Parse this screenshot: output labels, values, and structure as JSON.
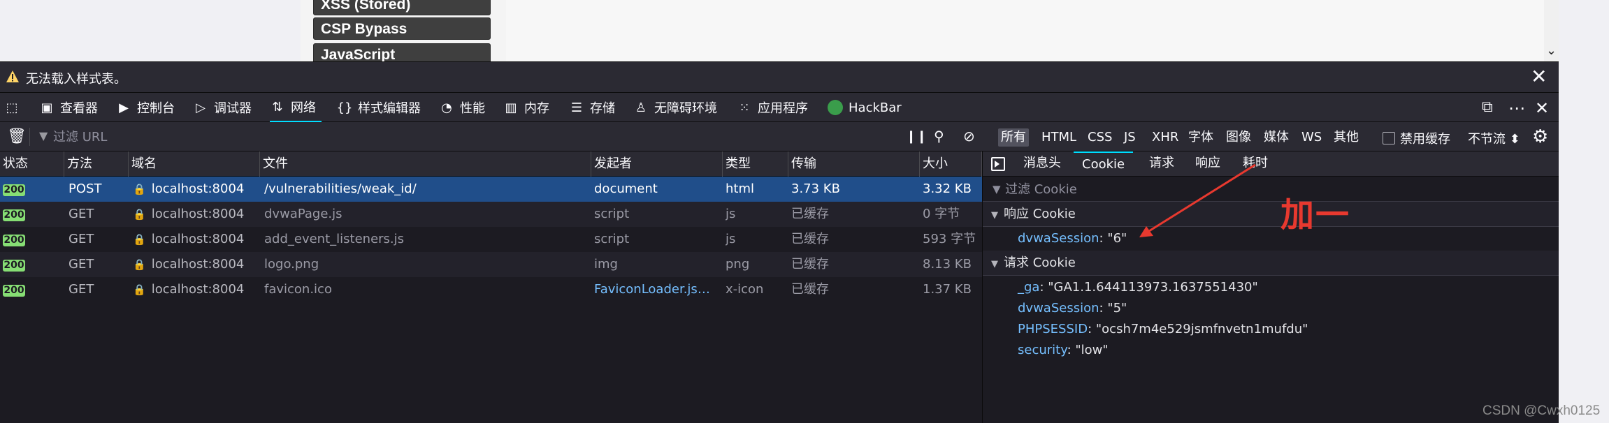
{
  "page": {
    "menu_items": [
      "XSS (Stored)",
      "CSP Bypass",
      "JavaScript"
    ]
  },
  "notice": {
    "text": "无法载入样式表。",
    "close": "✕"
  },
  "toolbar": {
    "tabs": [
      {
        "label": "查看器",
        "icon": "inspector-icon"
      },
      {
        "label": "控制台",
        "icon": "console-icon"
      },
      {
        "label": "调试器",
        "icon": "debugger-icon"
      },
      {
        "label": "网络",
        "icon": "network-icon",
        "active": true
      },
      {
        "label": "样式编辑器",
        "icon": "style-editor-icon"
      },
      {
        "label": "性能",
        "icon": "performance-icon"
      },
      {
        "label": "内存",
        "icon": "memory-icon"
      },
      {
        "label": "存储",
        "icon": "storage-icon"
      },
      {
        "label": "无障碍环境",
        "icon": "accessibility-icon"
      },
      {
        "label": "应用程序",
        "icon": "application-icon"
      },
      {
        "label": "HackBar",
        "icon": "hackbar-icon"
      }
    ]
  },
  "filter": {
    "placeholder": "过滤 URL",
    "types": [
      "所有",
      "HTML",
      "CSS",
      "JS",
      "XHR",
      "字体",
      "图像",
      "媒体",
      "WS",
      "其他"
    ],
    "active_type": "所有",
    "disable_cache": "禁用缓存",
    "throttle": "不节流 ⬍"
  },
  "table": {
    "headers": [
      "状态",
      "方法",
      "域名",
      "文件",
      "发起者",
      "类型",
      "传输",
      "大小"
    ],
    "rows": [
      {
        "status": "200",
        "method": "POST",
        "domain": "localhost:8004",
        "file": "/vulnerabilities/weak_id/",
        "initiator": "document",
        "type": "html",
        "transfer": "3.73 KB",
        "size": "3.32 KB"
      },
      {
        "status": "200",
        "method": "GET",
        "domain": "localhost:8004",
        "file": "dvwaPage.js",
        "initiator": "script",
        "type": "js",
        "transfer": "已缓存",
        "size": "0 字节"
      },
      {
        "status": "200",
        "method": "GET",
        "domain": "localhost:8004",
        "file": "add_event_listeners.js",
        "initiator": "script",
        "type": "js",
        "transfer": "已缓存",
        "size": "593 字节"
      },
      {
        "status": "200",
        "method": "GET",
        "domain": "localhost:8004",
        "file": "logo.png",
        "initiator": "img",
        "type": "png",
        "transfer": "已缓存",
        "size": "8.13 KB"
      },
      {
        "status": "200",
        "method": "GET",
        "domain": "localhost:8004",
        "file": "favicon.ico",
        "initiator": "FaviconLoader.jsm:1...",
        "type": "x-icon",
        "transfer": "已缓存",
        "size": "1.37 KB"
      }
    ]
  },
  "sidebar": {
    "tabs": [
      "消息头",
      "Cookie",
      "请求",
      "响应",
      "耗时"
    ],
    "active_tab": "Cookie",
    "filter_placeholder": "过滤 Cookie",
    "response_cookie_title": "响应 Cookie",
    "response_cookies": [
      {
        "key": "dvwaSession",
        "value": "\"6\""
      }
    ],
    "request_cookie_title": "请求 Cookie",
    "request_cookies": [
      {
        "key": "_ga",
        "value": "\"GA1.1.644113973.1637551430\""
      },
      {
        "key": "dvwaSession",
        "value": "\"5\""
      },
      {
        "key": "PHPSESSID",
        "value": "\"ocsh7m4e529jsmfnvetn1mufdu\""
      },
      {
        "key": "security",
        "value": "\"low\""
      }
    ]
  },
  "annotation": {
    "text": "加一",
    "color": "#e8392f"
  },
  "watermark": "CSDN @Cwxh0125"
}
